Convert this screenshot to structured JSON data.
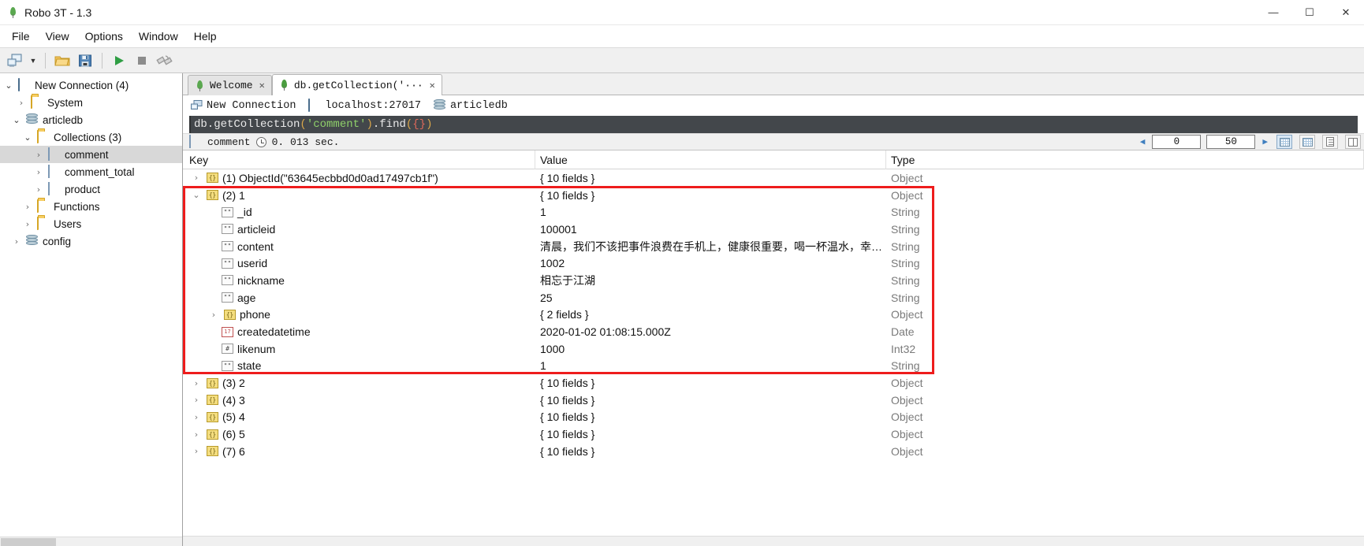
{
  "window": {
    "title": "Robo 3T - 1.3",
    "logo_icon": "robo3t-leaf-logo",
    "minimize": "—",
    "maximize": "☐",
    "close": "✕"
  },
  "menubar": [
    "File",
    "View",
    "Options",
    "Window",
    "Help"
  ],
  "toolbar": {
    "connect_label": "connect-icon",
    "caret": "▼",
    "open_label": "open-folder-icon",
    "save_label": "save-icon",
    "run_label": "▶",
    "stop_label": "■",
    "explain_label": "explain-icon"
  },
  "sidebar": {
    "items": [
      {
        "label": "New Connection (4)",
        "icon": "monitor-icon",
        "depth": 0,
        "twisty": "open",
        "selected": false
      },
      {
        "label": "System",
        "icon": "folder-icon",
        "depth": 1,
        "twisty": "closed",
        "selected": false
      },
      {
        "label": "articledb",
        "icon": "database-icon",
        "depth": 1,
        "twisty": "open",
        "selected": false
      },
      {
        "label": "Collections (3)",
        "icon": "folder-icon",
        "depth": 2,
        "twisty": "open",
        "selected": false
      },
      {
        "label": "comment",
        "icon": "collection-icon",
        "depth": 3,
        "twisty": "closed",
        "selected": true
      },
      {
        "label": "comment_total",
        "icon": "collection-icon",
        "depth": 3,
        "twisty": "closed",
        "selected": false
      },
      {
        "label": "product",
        "icon": "collection-icon",
        "depth": 3,
        "twisty": "closed",
        "selected": false
      },
      {
        "label": "Functions",
        "icon": "folder-icon",
        "depth": 2,
        "twisty": "closed",
        "selected": false
      },
      {
        "label": "Users",
        "icon": "folder-icon",
        "depth": 2,
        "twisty": "closed",
        "selected": false
      },
      {
        "label": "config",
        "icon": "database-icon",
        "depth": 1,
        "twisty": "closed",
        "selected": false
      }
    ]
  },
  "tabs": [
    {
      "label": "Welcome",
      "icon": "robo3t-leaf-logo",
      "close": "✕",
      "active": false
    },
    {
      "label": "db.getCollection('···",
      "icon": "mongo-leaf-icon",
      "close": "✕",
      "active": true
    }
  ],
  "connection_info": {
    "connection_name": "New Connection",
    "connection_icon": "server-icon",
    "host": "localhost:27017",
    "host_icon": "monitor-icon",
    "database": "articledb",
    "database_icon": "database-icon"
  },
  "editor": {
    "tokens": [
      {
        "text": "db.getCollection",
        "type": "plain"
      },
      {
        "text": "(",
        "type": "paren"
      },
      {
        "text": "'comment'",
        "type": "string"
      },
      {
        "text": ")",
        "type": "paren"
      },
      {
        "text": ".find",
        "type": "plain"
      },
      {
        "text": "(",
        "type": "paren"
      },
      {
        "text": "{}",
        "type": "brace"
      },
      {
        "text": ")",
        "type": "paren"
      }
    ],
    "full_text": "db.getCollection('comment').find({})"
  },
  "result_toolbar": {
    "collection": "comment",
    "collection_icon": "collection-icon",
    "clock_icon": "clock-icon",
    "elapsed": "0. 013 sec.",
    "prev_icon": "◀",
    "next_icon": "▶",
    "skip_value": "0",
    "limit_value": "50",
    "view_tree_icon": "tree-view-icon",
    "view_table_icon": "table-view-icon",
    "view_text_icon": "text-view-icon",
    "view_split_icon": "split-view-icon"
  },
  "results": {
    "columns": [
      "Key",
      "Value",
      "Type"
    ],
    "rows": [
      {
        "indent": 0,
        "twisty": "closed",
        "badge": "obj",
        "key": "(1) ObjectId(\"63645ecbbd0d0ad17497cb1f\")",
        "value": "{ 10 fields }",
        "type": "Object"
      },
      {
        "indent": 0,
        "twisty": "open",
        "badge": "obj",
        "key": "(2) 1",
        "value": "{ 10 fields }",
        "type": "Object"
      },
      {
        "indent": 1,
        "twisty": "none",
        "badge": "str",
        "key": "_id",
        "value": "1",
        "type": "String"
      },
      {
        "indent": 1,
        "twisty": "none",
        "badge": "str",
        "key": "articleid",
        "value": "100001",
        "type": "String"
      },
      {
        "indent": 1,
        "twisty": "none",
        "badge": "str",
        "key": "content",
        "value": "清晨，我们不该把事件浪费在手机上，健康很重要，喝一杯温水，幸福…",
        "type": "String"
      },
      {
        "indent": 1,
        "twisty": "none",
        "badge": "str",
        "key": "userid",
        "value": "1002",
        "type": "String"
      },
      {
        "indent": 1,
        "twisty": "none",
        "badge": "str",
        "key": "nickname",
        "value": "相忘于江湖",
        "type": "String"
      },
      {
        "indent": 1,
        "twisty": "none",
        "badge": "str",
        "key": "age",
        "value": "25",
        "type": "String"
      },
      {
        "indent": 1,
        "twisty": "closed",
        "badge": "obj",
        "key": "phone",
        "value": "{ 2 fields }",
        "type": "Object"
      },
      {
        "indent": 1,
        "twisty": "none",
        "badge": "date",
        "key": "createdatetime",
        "value": "2020-01-02 01:08:15.000Z",
        "type": "Date"
      },
      {
        "indent": 1,
        "twisty": "none",
        "badge": "int",
        "key": "likenum",
        "value": "1000",
        "type": "Int32"
      },
      {
        "indent": 1,
        "twisty": "none",
        "badge": "str",
        "key": "state",
        "value": "1",
        "type": "String"
      },
      {
        "indent": 0,
        "twisty": "closed",
        "badge": "obj",
        "key": "(3) 2",
        "value": "{ 10 fields }",
        "type": "Object"
      },
      {
        "indent": 0,
        "twisty": "closed",
        "badge": "obj",
        "key": "(4) 3",
        "value": "{ 10 fields }",
        "type": "Object"
      },
      {
        "indent": 0,
        "twisty": "closed",
        "badge": "obj",
        "key": "(5) 4",
        "value": "{ 10 fields }",
        "type": "Object"
      },
      {
        "indent": 0,
        "twisty": "closed",
        "badge": "obj",
        "key": "(6) 5",
        "value": "{ 10 fields }",
        "type": "Object"
      },
      {
        "indent": 0,
        "twisty": "closed",
        "badge": "obj",
        "key": "(7) 6",
        "value": "{ 10 fields }",
        "type": "Object"
      }
    ],
    "highlight": {
      "color": "#ee1c1c",
      "first_row_index": 1,
      "last_row_index": 11
    }
  }
}
